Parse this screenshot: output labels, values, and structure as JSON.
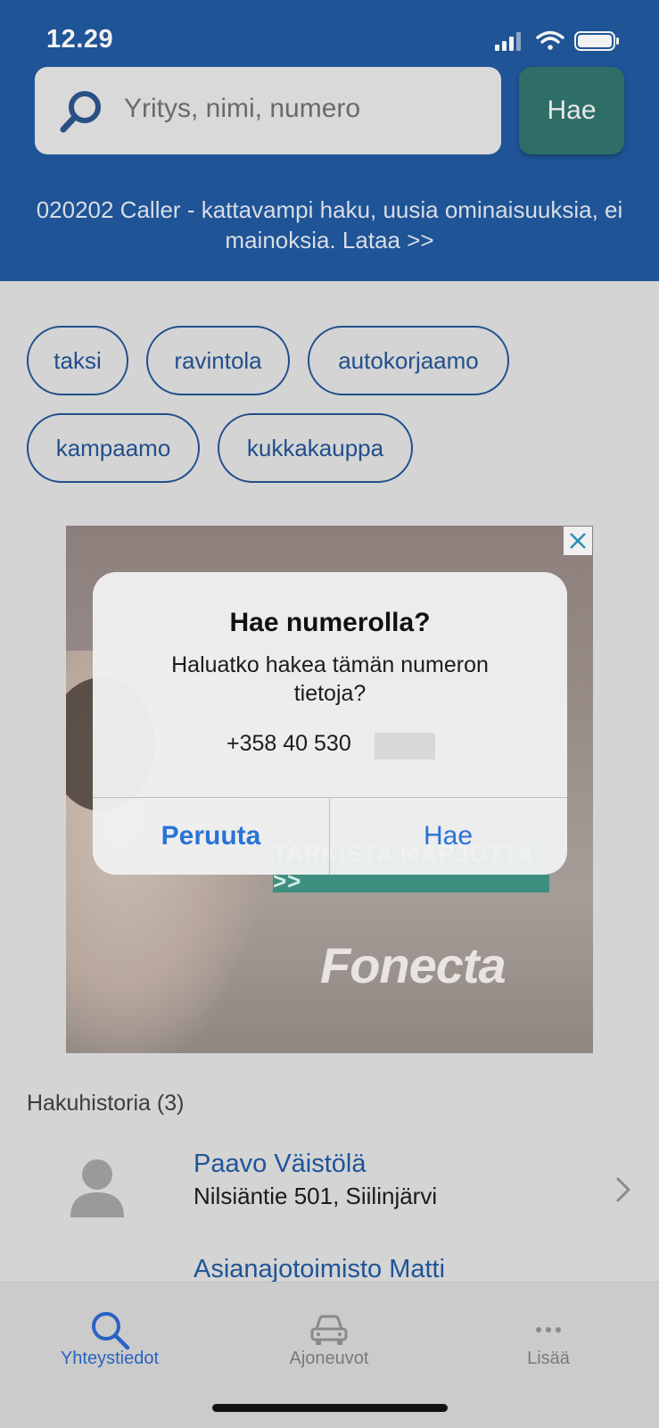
{
  "status_bar": {
    "time": "12.29"
  },
  "search": {
    "placeholder": "Yritys, nimi, numero",
    "button_label": "Hae"
  },
  "promo_text": "020202 Caller - kattavampi haku, uusia ominaisuuksia, ei mainoksia. Lataa >>",
  "categories": [
    "taksi",
    "ravintola",
    "autokorjaamo",
    "kampaamo",
    "kukkakauppa"
  ],
  "ad": {
    "cta_text": "TARKISTA MARJOTTA >>",
    "logo_text": "Fonecta",
    "close_icon": "close-icon"
  },
  "dialog": {
    "title": "Hae numerolla?",
    "message": "Haluatko hakea tämän numeron tietoja?",
    "number": "+358 40 530",
    "cancel_label": "Peruuta",
    "confirm_label": "Hae"
  },
  "history": {
    "title": "Hakuhistoria (3)",
    "entries": [
      {
        "name": "Paavo Väistölä",
        "address": "Nilsiäntie 501, Siilinjärvi"
      },
      {
        "name": "Asianajotoimisto Matti"
      }
    ]
  },
  "tabs": [
    {
      "label": "Yhteystiedot",
      "icon": "search-icon",
      "active": true
    },
    {
      "label": "Ajoneuvot",
      "icon": "car-icon",
      "active": false
    },
    {
      "label": "Lisää",
      "icon": "more-icon",
      "active": false
    }
  ],
  "colors": {
    "header": "#1f5496",
    "accent": "#2a73d6",
    "search_button": "#2e6e66",
    "tab_active": "#2b62c4",
    "tab_inactive": "#8a8a8a"
  }
}
